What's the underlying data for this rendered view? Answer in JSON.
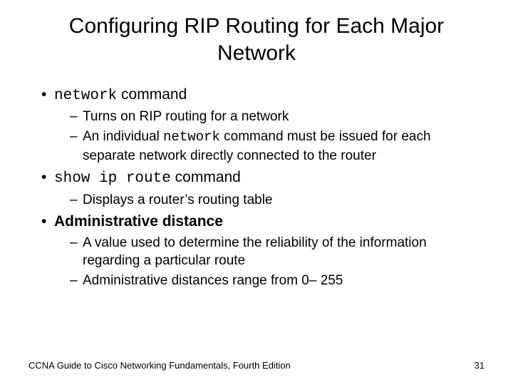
{
  "title": "Configuring RIP Routing for Each Major Network",
  "b1": {
    "cmd": "network",
    "suffix": " command",
    "s1": "Turns on RIP routing for a network",
    "s2a": "An individual ",
    "s2cmd": "network",
    "s2b": " command must be issued for each separate network directly connected to the router"
  },
  "b2": {
    "cmd": "show ip route",
    "suffix": " command",
    "s1": "Displays a router’s routing table"
  },
  "b3": {
    "label": "Administrative distance",
    "s1": "A value used to determine the reliability of the information regarding a particular route",
    "s2": "Administrative distances range from 0– 255"
  },
  "footer": {
    "text": "CCNA Guide to Cisco Networking Fundamentals, Fourth Edition",
    "page": "31"
  }
}
